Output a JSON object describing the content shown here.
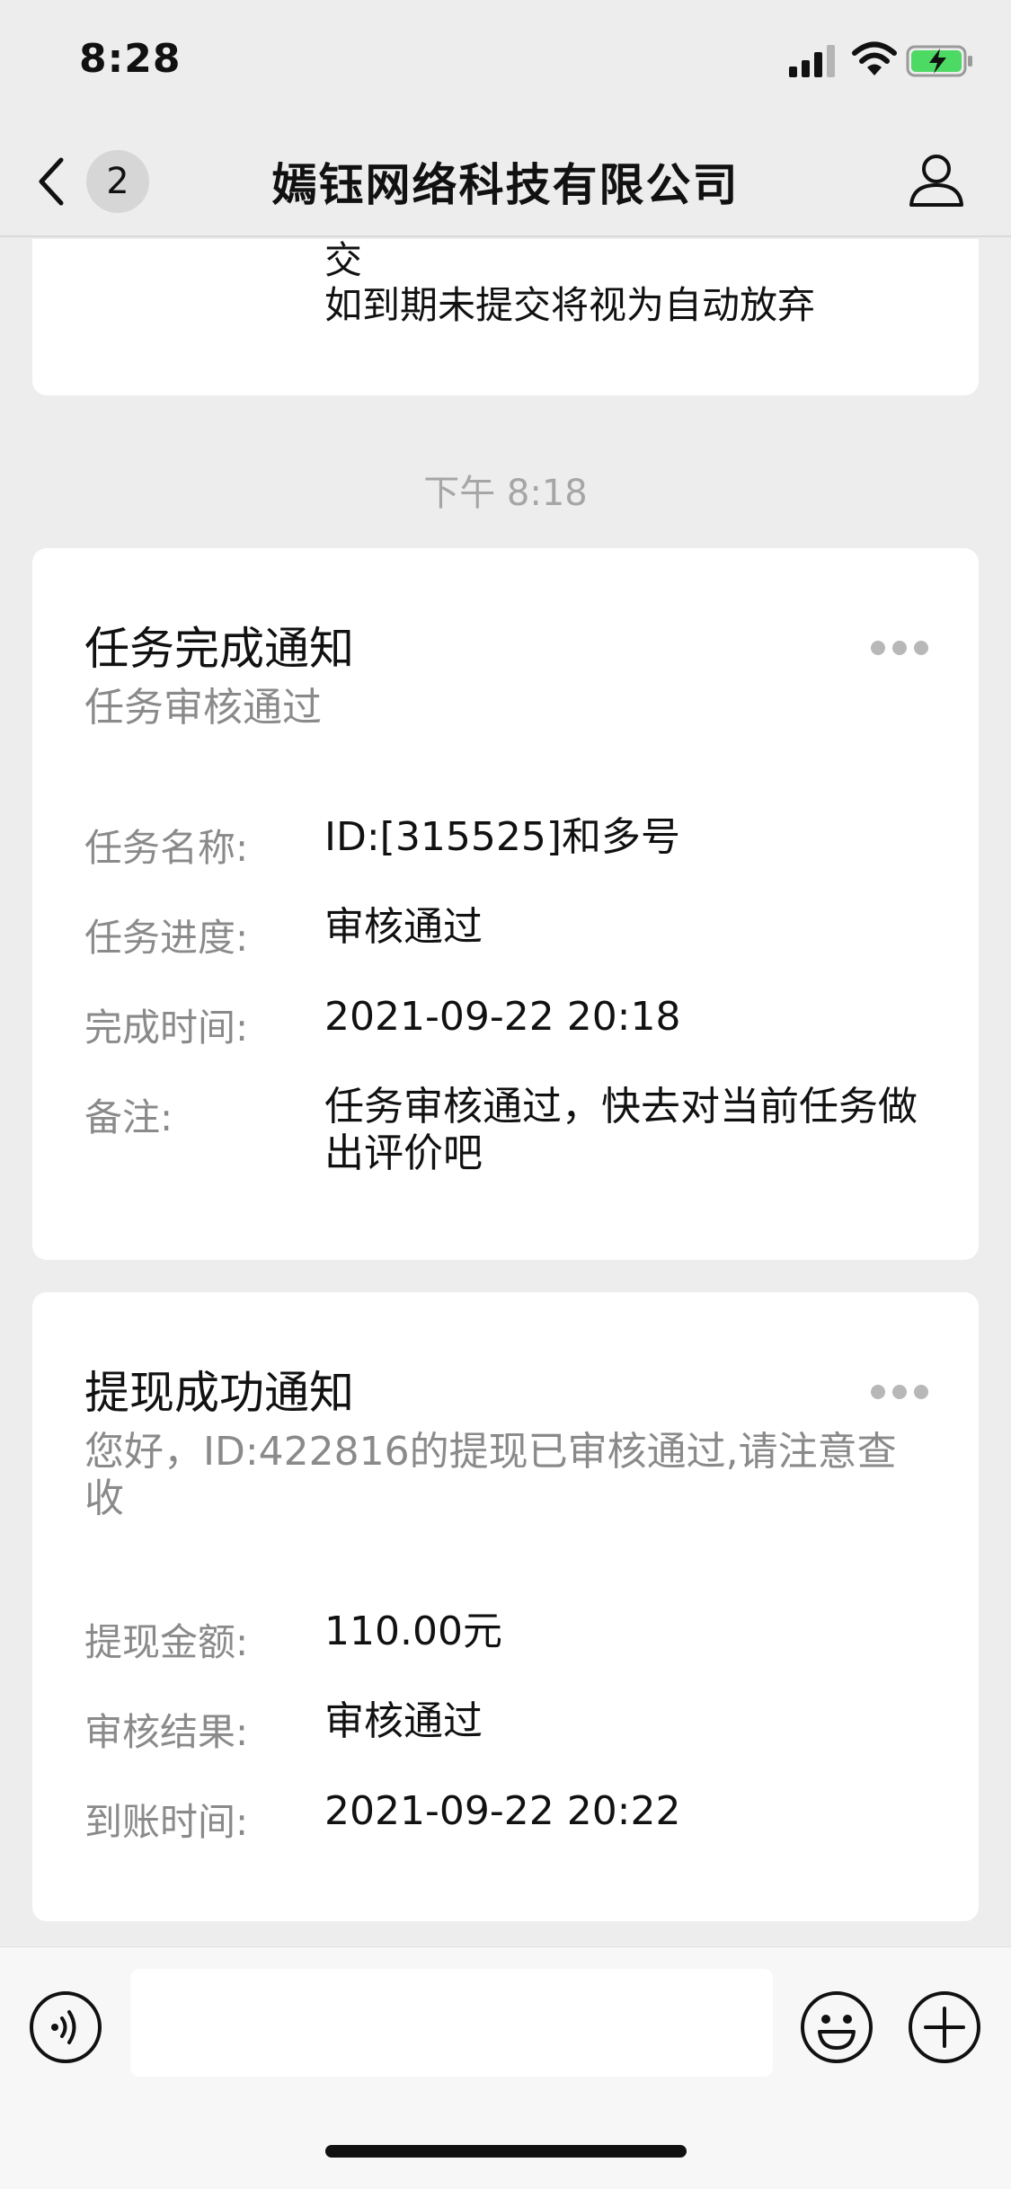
{
  "status_bar": {
    "time": "8:28"
  },
  "nav": {
    "unread_count": "2",
    "title": "嫣钰网络科技有限公司"
  },
  "previous_message": {
    "lines": [
      "交",
      "如到期未提交将视为自动放弃"
    ]
  },
  "timestamp": "下午 8:18",
  "task_card": {
    "title": "任务完成通知",
    "subtitle": "任务审核通过",
    "fields": [
      {
        "label": "任务名称:",
        "value": "ID:[315525]和多号"
      },
      {
        "label": "任务进度:",
        "value": "审核通过"
      },
      {
        "label": "完成时间:",
        "value": "2021-09-22 20:18"
      },
      {
        "label": "备注:",
        "value": "任务审核通过，快去对当前任务做出评价吧"
      }
    ]
  },
  "withdraw_card": {
    "title": "提现成功通知",
    "subtitle": "您好，ID:422816的提现已审核通过,请注意查收",
    "fields": [
      {
        "label": "提现金额:",
        "value": "110.00元"
      },
      {
        "label": "审核结果:",
        "value": "审核通过"
      },
      {
        "label": "到账时间:",
        "value": "2021-09-22 20:22"
      }
    ]
  },
  "input": {
    "value": ""
  },
  "colors": {
    "background": "#ededed",
    "card": "#ffffff",
    "muted_text": "#8a8a8a",
    "battery_green": "#4cd964"
  }
}
